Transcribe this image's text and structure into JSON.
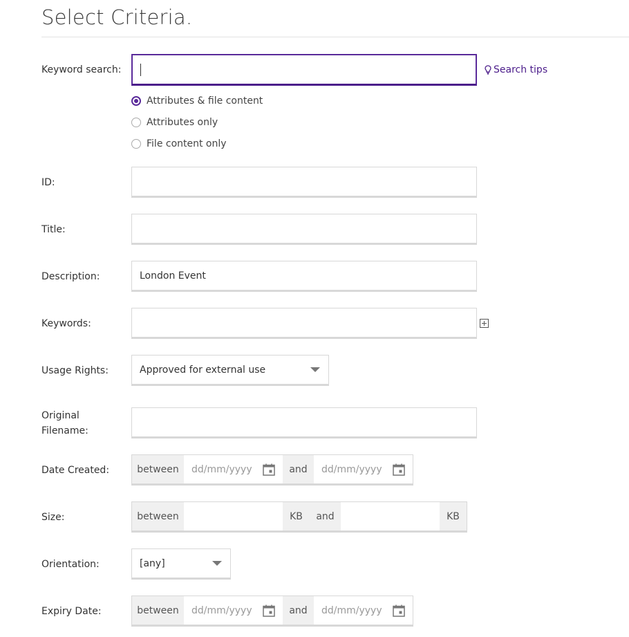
{
  "header": {
    "title": "Select Criteria."
  },
  "keyword": {
    "label": "Keyword search:",
    "value": "",
    "search_tips": "Search tips",
    "options": [
      {
        "label": "Attributes & file content",
        "checked": true
      },
      {
        "label": "Attributes only",
        "checked": false
      },
      {
        "label": "File content only",
        "checked": false
      }
    ]
  },
  "id_field": {
    "label": "ID:",
    "value": ""
  },
  "title_field": {
    "label": "Title:",
    "value": ""
  },
  "description_field": {
    "label": "Description:",
    "value": "London Event"
  },
  "keywords_field": {
    "label": "Keywords:",
    "value": ""
  },
  "usage_rights": {
    "label": "Usage Rights:",
    "selected": "Approved for external use"
  },
  "original_filename": {
    "label_line1": "Original",
    "label_line2": "Filename:",
    "value": ""
  },
  "date_created": {
    "label": "Date Created:",
    "between": "between",
    "and": "and",
    "from_placeholder": "dd/mm/yyyy",
    "to_placeholder": "dd/mm/yyyy"
  },
  "size": {
    "label": "Size:",
    "between": "between",
    "and": "and",
    "unit_from": "KB",
    "unit_to": "KB"
  },
  "orientation": {
    "label": "Orientation:",
    "selected": "[any]"
  },
  "expiry_date": {
    "label": "Expiry Date:",
    "between": "between",
    "and": "and",
    "from_placeholder": "dd/mm/yyyy",
    "to_placeholder": "dd/mm/yyyy"
  },
  "colors": {
    "accent": "#5a2a9a",
    "link": "#4b1c8a",
    "border": "#d8d8d8",
    "addon_bg": "#f0f0f0"
  }
}
